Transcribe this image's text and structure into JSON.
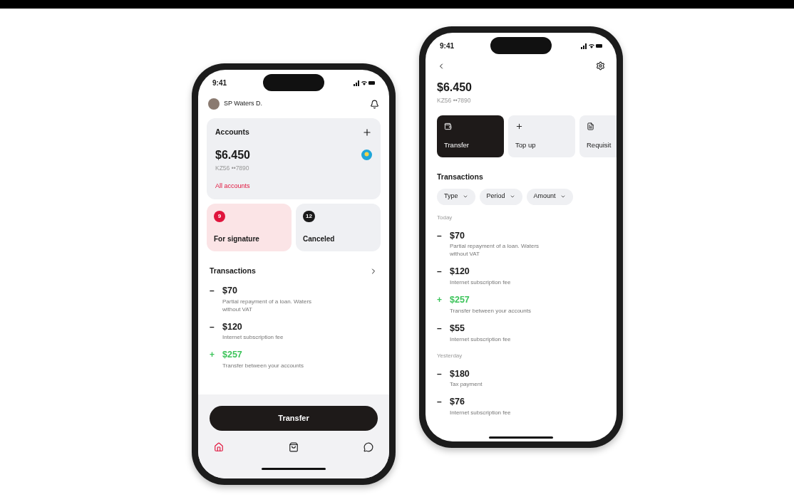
{
  "home_screen": {
    "status_time": "9:41",
    "user_name": "SP Waters D.",
    "accounts_card": {
      "title": "Accounts",
      "balance": "$6.450",
      "account": "KZ56 ••7890",
      "link": "All accounts"
    },
    "tiles": [
      {
        "kind": "alert",
        "count": "9",
        "label": "For signature"
      },
      {
        "kind": "neutral",
        "count": "12",
        "label": "Canceled"
      }
    ],
    "transactions_title": "Transactions",
    "transactions": [
      {
        "kind": "debit",
        "sign": "–",
        "amount": "$70",
        "description": "Partial repayment of a loan. Waters without VAT"
      },
      {
        "kind": "debit",
        "sign": "–",
        "amount": "$120",
        "description": "Internet subscription fee"
      },
      {
        "kind": "credit",
        "sign": "+",
        "amount": "$257",
        "description": "Transfer between your accounts"
      }
    ],
    "transfer_button": "Transfer",
    "tab_bar": [
      {
        "kind": "home",
        "selected": true
      },
      {
        "kind": "bag",
        "selected": false
      },
      {
        "kind": "chat",
        "selected": false
      }
    ]
  },
  "account_screen": {
    "status_time": "9:41",
    "balance": "$6.450",
    "account": "KZ56 ••7890",
    "actions": [
      {
        "kind": "transfer",
        "label": "Transfer",
        "selected": true
      },
      {
        "kind": "topup",
        "label": "Top up",
        "selected": false
      },
      {
        "kind": "document",
        "label": "Requisit",
        "selected": false
      }
    ],
    "transactions_title": "Transactions",
    "filters": [
      "Type",
      "Period",
      "Amount"
    ],
    "groups": [
      {
        "label": "Today",
        "items": [
          {
            "kind": "debit",
            "sign": "–",
            "amount": "$70",
            "description": "Partial repayment of a loan. Waters without VAT"
          },
          {
            "kind": "debit",
            "sign": "–",
            "amount": "$120",
            "description": "Internet subscription fee"
          },
          {
            "kind": "credit",
            "sign": "+",
            "amount": "$257",
            "description": "Transfer between your accounts"
          },
          {
            "kind": "debit",
            "sign": "–",
            "amount": "$55",
            "description": "Internet subscription fee"
          }
        ]
      },
      {
        "label": "Yesterday",
        "items": [
          {
            "kind": "debit",
            "sign": "–",
            "amount": "$180",
            "description": "Tax payment"
          },
          {
            "kind": "debit",
            "sign": "–",
            "amount": "$76",
            "description": "Internet subscription fee"
          }
        ]
      }
    ]
  }
}
